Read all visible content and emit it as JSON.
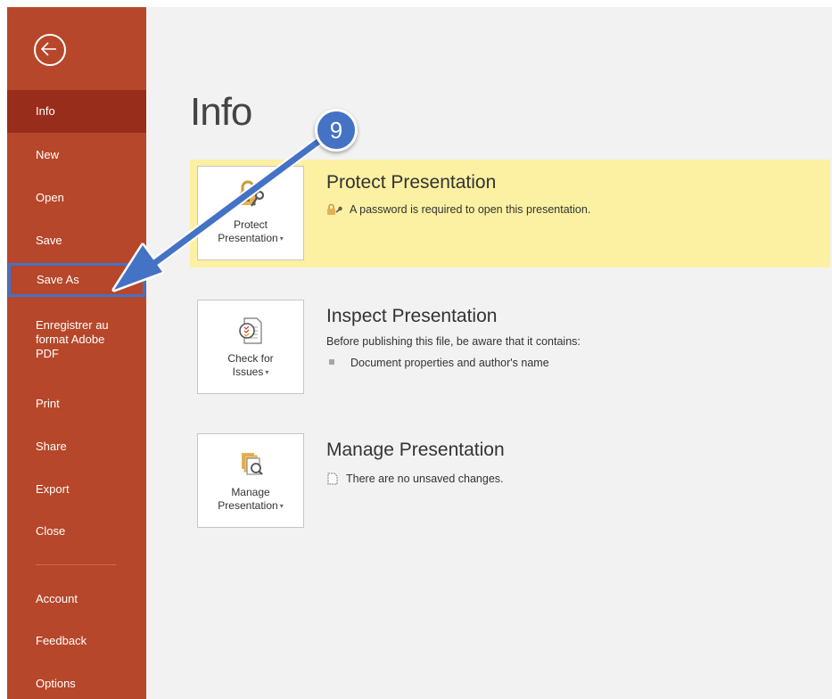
{
  "sidebar": {
    "back_label": "Back",
    "items": [
      {
        "label": "Info"
      },
      {
        "label": "New"
      },
      {
        "label": "Open"
      },
      {
        "label": "Save"
      },
      {
        "label": "Save As"
      },
      {
        "label": "Enregistrer au format Adobe PDF"
      },
      {
        "label": "Print"
      },
      {
        "label": "Share"
      },
      {
        "label": "Export"
      },
      {
        "label": "Close"
      },
      {
        "label": "Account"
      },
      {
        "label": "Feedback"
      },
      {
        "label": "Options"
      }
    ]
  },
  "main": {
    "title": "Info",
    "sections": {
      "protect": {
        "button_line1": "Protect",
        "button_line2": "Presentation",
        "title": "Protect Presentation",
        "description": "A password is required to open this presentation."
      },
      "inspect": {
        "button_line1": "Check for",
        "button_line2": "Issues",
        "title": "Inspect Presentation",
        "description": "Before publishing this file, be aware that it contains:",
        "bullet": "Document properties and author's name"
      },
      "manage": {
        "button_line1": "Manage",
        "button_line2": "Presentation",
        "title": "Manage Presentation",
        "description": "There are no unsaved changes."
      }
    }
  },
  "annotation": {
    "step_number": "9"
  },
  "colors": {
    "sidebar": "#b7472a",
    "sidebar_active": "#992d1b",
    "highlight": "#fcf0a2",
    "callout": "#4472c4"
  }
}
